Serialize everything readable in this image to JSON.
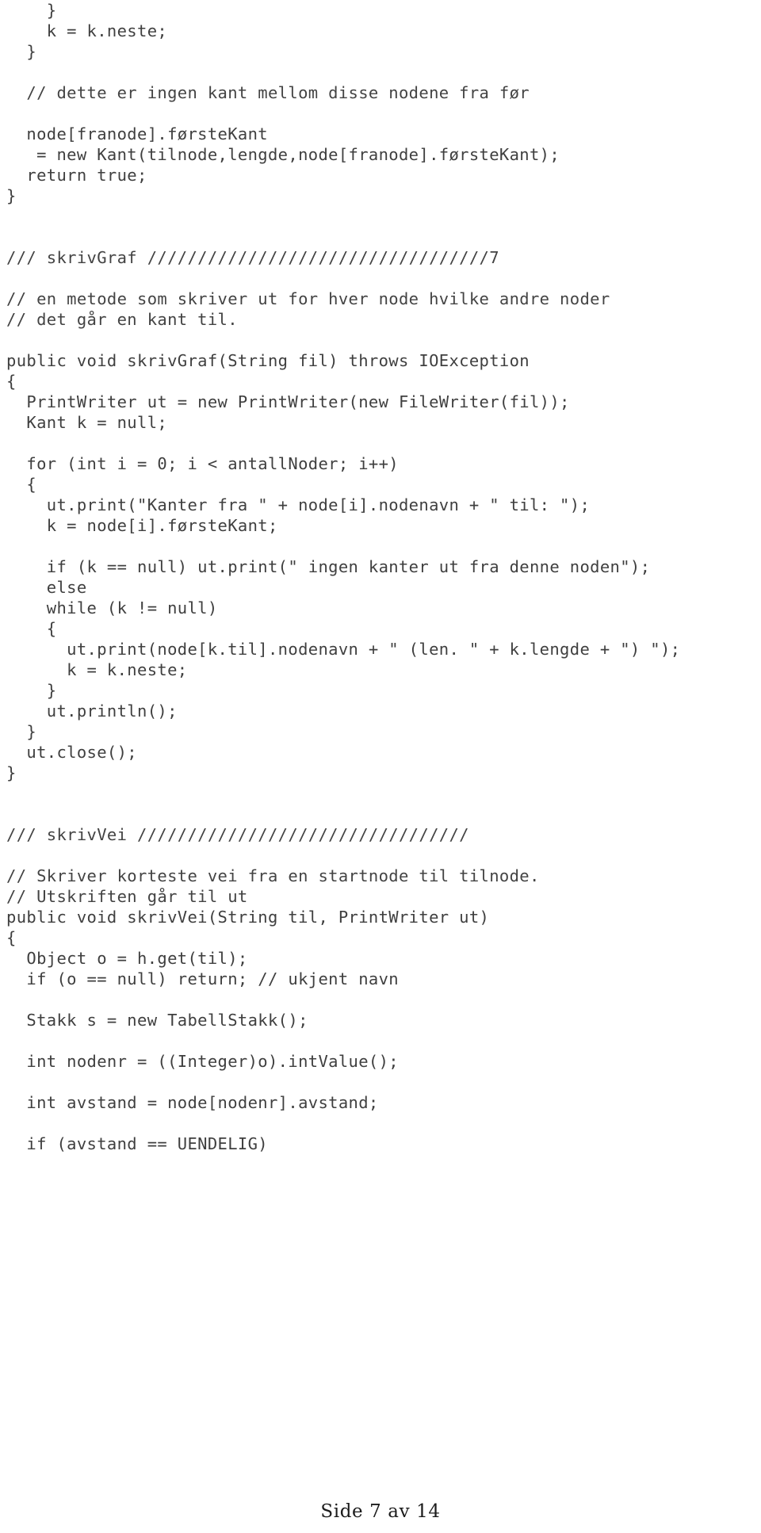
{
  "document": {
    "page_footer": "Side 7 av 14",
    "page_number": 7,
    "page_total": 14,
    "language": "Java",
    "text_color": "#3f3f3f",
    "background_color": "#ffffff"
  },
  "code": {
    "lines": [
      "    }",
      "    k = k.neste;",
      "  }",
      "",
      "  // dette er ingen kant mellom disse nodene fra før",
      "",
      "  node[franode].førsteKant",
      "   = new Kant(tilnode,lengde,node[franode].førsteKant);",
      "  return true;",
      "}",
      "",
      "",
      "/// skrivGraf //////////////////////////////////7",
      "",
      "// en metode som skriver ut for hver node hvilke andre noder",
      "// det går en kant til.",
      "",
      "public void skrivGraf(String fil) throws IOException",
      "{",
      "  PrintWriter ut = new PrintWriter(new FileWriter(fil));",
      "  Kant k = null;",
      "",
      "  for (int i = 0; i < antallNoder; i++)",
      "  {",
      "    ut.print(\"Kanter fra \" + node[i].nodenavn + \" til: \");",
      "    k = node[i].førsteKant;",
      "",
      "    if (k == null) ut.print(\" ingen kanter ut fra denne noden\");",
      "    else",
      "    while (k != null)",
      "    {",
      "      ut.print(node[k.til].nodenavn + \" (len. \" + k.lengde + \") \");",
      "      k = k.neste;",
      "    }",
      "    ut.println();",
      "  }",
      "  ut.close();",
      "}",
      "",
      "",
      "/// skrivVei /////////////////////////////////",
      "",
      "// Skriver korteste vei fra en startnode til tilnode.",
      "// Utskriften går til ut",
      "public void skrivVei(String til, PrintWriter ut)",
      "{",
      "  Object o = h.get(til);",
      "  if (o == null) return; // ukjent navn",
      "",
      "  Stakk s = new TabellStakk();",
      "",
      "  int nodenr = ((Integer)o).intValue();",
      "",
      "  int avstand = node[nodenr].avstand;",
      "",
      "  if (avstand == UENDELIG)"
    ]
  }
}
